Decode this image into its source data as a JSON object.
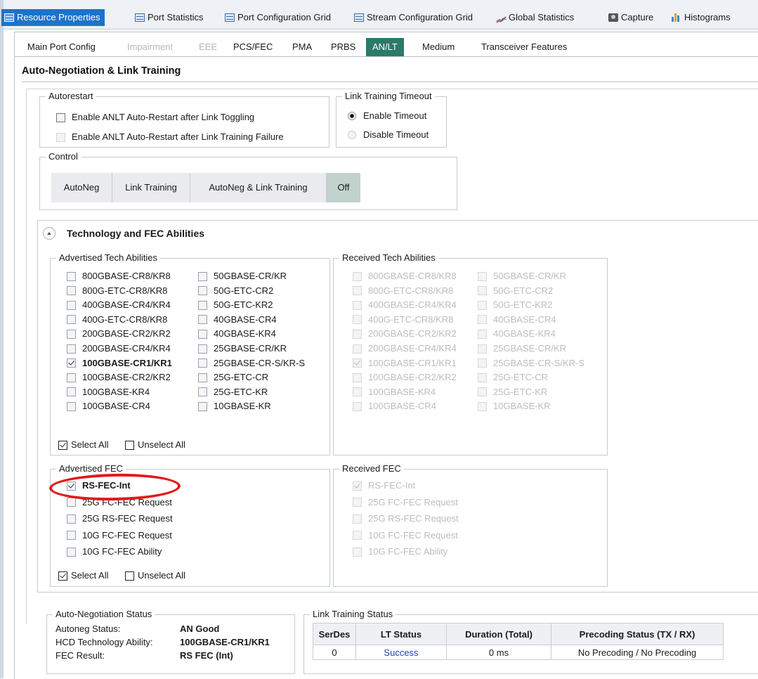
{
  "top_tabs": [
    {
      "label": "Resource Properties",
      "icon": "grid-icon",
      "active": true
    },
    {
      "label": "Port Statistics",
      "icon": "grid-icon"
    },
    {
      "label": "Port Configuration Grid",
      "icon": "grid-icon"
    },
    {
      "label": "Stream Configuration Grid",
      "icon": "grid-arrow-icon"
    },
    {
      "label": "Global Statistics",
      "icon": "line-chart-icon"
    },
    {
      "label": "Capture",
      "icon": "camera-icon"
    },
    {
      "label": "Histograms",
      "icon": "bar-chart-icon"
    }
  ],
  "sub_tabs": [
    {
      "label": "Main Port Config"
    },
    {
      "label": "Impairment",
      "disabled": true
    },
    {
      "label": "EEE",
      "disabled": true
    },
    {
      "label": "PCS/FEC"
    },
    {
      "label": "PMA"
    },
    {
      "label": "PRBS"
    },
    {
      "label": "AN/LT",
      "active": true
    },
    {
      "label": "Medium"
    },
    {
      "label": "Transceiver Features"
    }
  ],
  "page_title": "Auto-Negotiation & Link Training",
  "autorestart": {
    "label": "Autorestart",
    "options": [
      {
        "label": "Enable ANLT Auto-Restart after Link Toggling",
        "checked": false,
        "disabled": false
      },
      {
        "label": "Enable ANLT Auto-Restart after Link Training Failure",
        "checked": false,
        "disabled": true
      }
    ]
  },
  "lt_timeout": {
    "label": "Link Training Timeout",
    "options": [
      {
        "label": "Enable Timeout",
        "selected": true
      },
      {
        "label": "Disable Timeout",
        "selected": false
      }
    ]
  },
  "control": {
    "label": "Control",
    "buttons": [
      "AutoNeg",
      "Link Training",
      "AutoNeg & Link Training",
      "Off"
    ],
    "active": "Off"
  },
  "tech_fec_section": "Technology and FEC Abilities",
  "advertised_tech": {
    "label": "Advertised Tech Abilities",
    "col1": [
      {
        "label": "800GBASE-CR8/KR8",
        "checked": false
      },
      {
        "label": "800G-ETC-CR8/KR8",
        "checked": false
      },
      {
        "label": "400GBASE-CR4/KR4",
        "checked": false
      },
      {
        "label": "400G-ETC-CR8/KR8",
        "checked": false
      },
      {
        "label": "200GBASE-CR2/KR2",
        "checked": false
      },
      {
        "label": "200GBASE-CR4/KR4",
        "checked": false
      },
      {
        "label": "100GBASE-CR1/KR1",
        "checked": true
      },
      {
        "label": "100GBASE-CR2/KR2",
        "checked": false
      },
      {
        "label": "100GBASE-KR4",
        "checked": false
      },
      {
        "label": "100GBASE-CR4",
        "checked": false
      }
    ],
    "col2": [
      {
        "label": "50GBASE-CR/KR",
        "checked": false
      },
      {
        "label": "50G-ETC-CR2",
        "checked": false
      },
      {
        "label": "50G-ETC-KR2",
        "checked": false
      },
      {
        "label": "40GBASE-CR4",
        "checked": false
      },
      {
        "label": "40GBASE-KR4",
        "checked": false
      },
      {
        "label": "25GBASE-CR/KR",
        "checked": false
      },
      {
        "label": "25GBASE-CR-S/KR-S",
        "checked": false
      },
      {
        "label": "25G-ETC-CR",
        "checked": false
      },
      {
        "label": "25G-ETC-KR",
        "checked": false
      },
      {
        "label": "10GBASE-KR",
        "checked": false
      }
    ],
    "select_all": "Select All",
    "unselect_all": "Unselect All"
  },
  "received_tech": {
    "label": "Received Tech Abilities",
    "col1": [
      {
        "label": "800GBASE-CR8/KR8",
        "checked": false
      },
      {
        "label": "800G-ETC-CR8/KR8",
        "checked": false
      },
      {
        "label": "400GBASE-CR4/KR4",
        "checked": false
      },
      {
        "label": "400G-ETC-CR8/KR8",
        "checked": false
      },
      {
        "label": "200GBASE-CR2/KR2",
        "checked": false
      },
      {
        "label": "200GBASE-CR4/KR4",
        "checked": false
      },
      {
        "label": "100GBASE-CR1/KR1",
        "checked": true
      },
      {
        "label": "100GBASE-CR2/KR2",
        "checked": false
      },
      {
        "label": "100GBASE-KR4",
        "checked": false
      },
      {
        "label": "100GBASE-CR4",
        "checked": false
      }
    ],
    "col2": [
      {
        "label": "50GBASE-CR/KR",
        "checked": false
      },
      {
        "label": "50G-ETC-CR2",
        "checked": false
      },
      {
        "label": "50G-ETC-KR2",
        "checked": false
      },
      {
        "label": "40GBASE-CR4",
        "checked": false
      },
      {
        "label": "40GBASE-KR4",
        "checked": false
      },
      {
        "label": "25GBASE-CR/KR",
        "checked": false
      },
      {
        "label": "25GBASE-CR-S/KR-S",
        "checked": false
      },
      {
        "label": "25G-ETC-CR",
        "checked": false
      },
      {
        "label": "25G-ETC-KR",
        "checked": false
      },
      {
        "label": "10GBASE-KR",
        "checked": false
      }
    ]
  },
  "advertised_fec": {
    "label": "Advertised FEC",
    "items": [
      {
        "label": "RS-FEC-Int",
        "checked": true
      },
      {
        "label": "25G FC-FEC Request",
        "checked": false
      },
      {
        "label": "25G RS-FEC Request",
        "checked": false
      },
      {
        "label": "10G FC-FEC Request",
        "checked": false
      },
      {
        "label": "10G FC-FEC Ability",
        "checked": false
      }
    ],
    "select_all": "Select All",
    "unselect_all": "Unselect All"
  },
  "received_fec": {
    "label": "Received FEC",
    "items": [
      {
        "label": "RS-FEC-Int",
        "checked": true
      },
      {
        "label": "25G FC-FEC Request",
        "checked": false
      },
      {
        "label": "25G RS-FEC Request",
        "checked": false
      },
      {
        "label": "10G FC-FEC Request",
        "checked": false
      },
      {
        "label": "10G FC-FEC Ability",
        "checked": false
      }
    ]
  },
  "an_status": {
    "label": "Auto-Negotiation Status",
    "rows": [
      {
        "key": "Autoneg Status:",
        "value": "AN Good"
      },
      {
        "key": "HCD Technology Ability:",
        "value": "100GBASE-CR1/KR1"
      },
      {
        "key": "FEC Result:",
        "value": "RS FEC (Int)"
      }
    ]
  },
  "lt_status": {
    "label": "Link Training Status",
    "columns": [
      "SerDes",
      "LT Status",
      "Duration (Total)",
      "Precoding Status (TX / RX)"
    ],
    "rows": [
      [
        "0",
        "Success",
        "0 ms",
        "No Precoding / No Precoding"
      ]
    ]
  },
  "colors": {
    "active_top_tab": "#1d73c9",
    "active_sub_tab": "#2b7a6b",
    "control_active": "#c2d2cd",
    "annotation": "#e3191c",
    "link": "#1f3fcf"
  }
}
